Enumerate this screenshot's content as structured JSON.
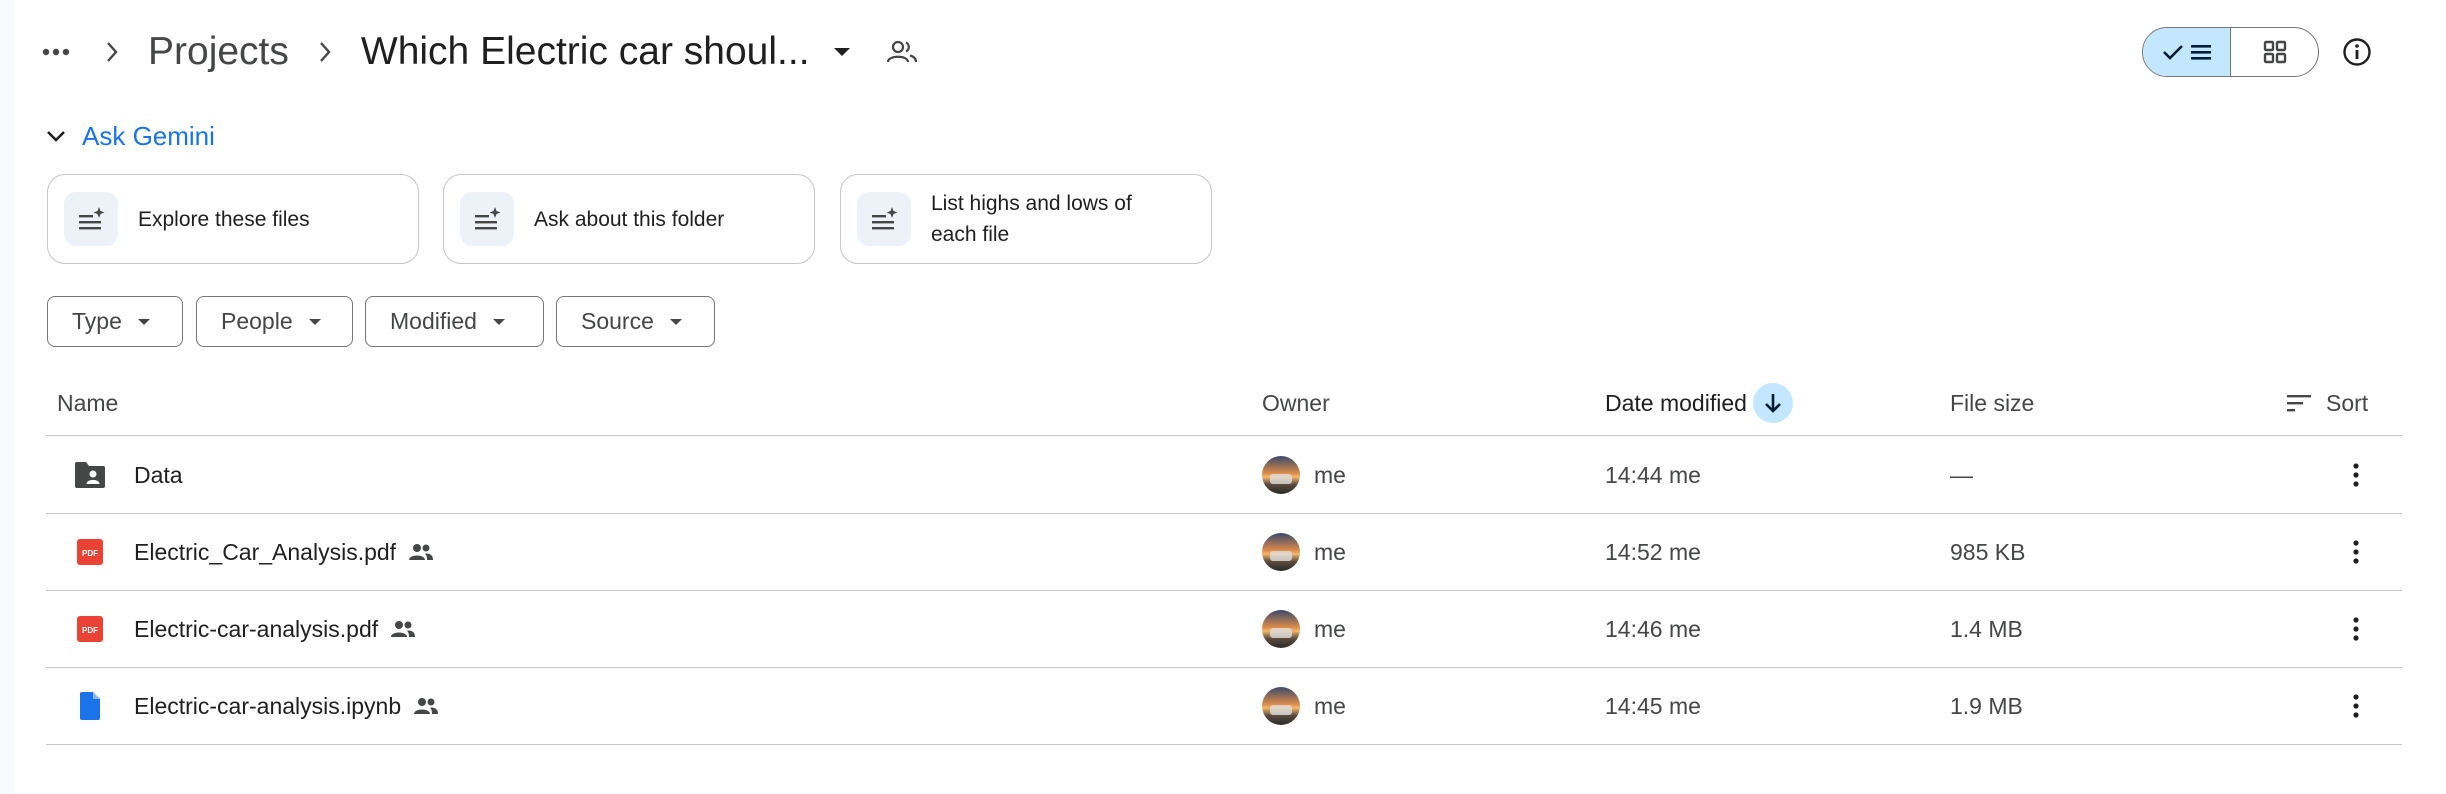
{
  "breadcrumb": {
    "parent": "Projects",
    "current": "Which Electric car shoul..."
  },
  "gemini": {
    "label": "Ask Gemini",
    "suggestions": [
      {
        "text": "Explore these files"
      },
      {
        "text": "Ask about this folder"
      },
      {
        "text": "List highs and lows of each file"
      }
    ]
  },
  "filters": [
    {
      "label": "Type"
    },
    {
      "label": "People"
    },
    {
      "label": "Modified"
    },
    {
      "label": "Source"
    }
  ],
  "table": {
    "headers": {
      "name": "Name",
      "owner": "Owner",
      "date": "Date modified",
      "size": "File size",
      "sort": "Sort"
    },
    "rows": [
      {
        "name": "Data",
        "type": "shared-folder",
        "shared": false,
        "owner": "me",
        "modified": "14:44 me",
        "size": "—"
      },
      {
        "name": "Electric_Car_Analysis.pdf",
        "type": "pdf",
        "shared": true,
        "owner": "me",
        "modified": "14:52 me",
        "size": "985 KB"
      },
      {
        "name": "Electric-car-analysis.pdf",
        "type": "pdf",
        "shared": true,
        "owner": "me",
        "modified": "14:46 me",
        "size": "1.4 MB"
      },
      {
        "name": "Electric-car-analysis.ipynb",
        "type": "doc",
        "shared": true,
        "owner": "me",
        "modified": "14:45 me",
        "size": "1.9 MB"
      }
    ]
  },
  "icons": {
    "pdf_label": "PDF",
    "pdf_color": "#ea4335",
    "doc_color": "#1a73e8",
    "accent": "#1a73e8",
    "selected_bg": "#c2e7ff"
  }
}
